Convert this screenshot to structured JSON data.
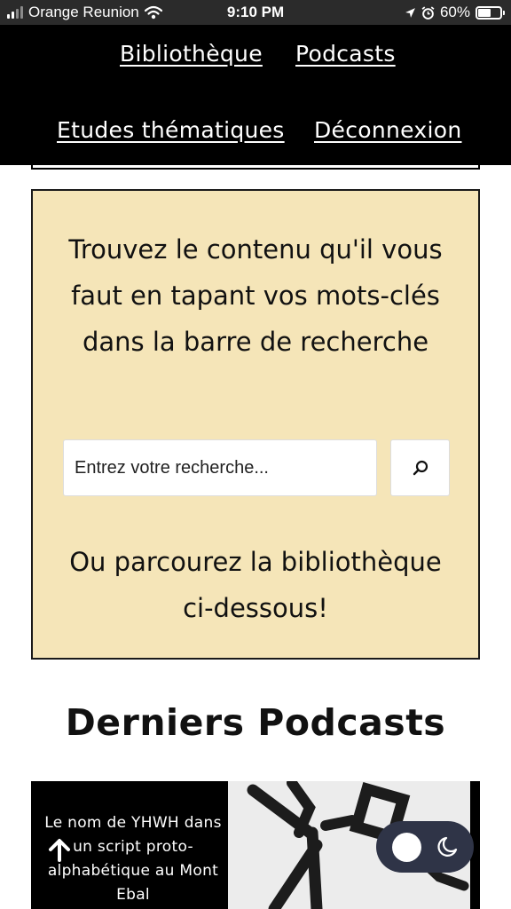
{
  "status_bar": {
    "carrier": "Orange Reunion",
    "time": "9:10 PM",
    "battery": "60%",
    "battery_level": 0.6
  },
  "nav": {
    "links": [
      "Bibliothèque",
      "Podcasts",
      "Etudes thématiques",
      "Déconnexion"
    ]
  },
  "search_panel": {
    "heading": "Trouvez le contenu qu'il vous faut en tapant vos mots-clés dans la barre de recherche",
    "placeholder": "Entrez votre recherche...",
    "subtext": "Ou parcourez la bibliothèque ci-dessous!"
  },
  "podcasts": {
    "section_title": "Derniers Podcasts",
    "first_card_title": "Le nom de YHWH dans un script proto-alphabétique au Mont Ebal"
  },
  "colors": {
    "nav_background": "#000000",
    "panel_background": "#f5e5b8",
    "toggle_background": "#2f3447"
  }
}
